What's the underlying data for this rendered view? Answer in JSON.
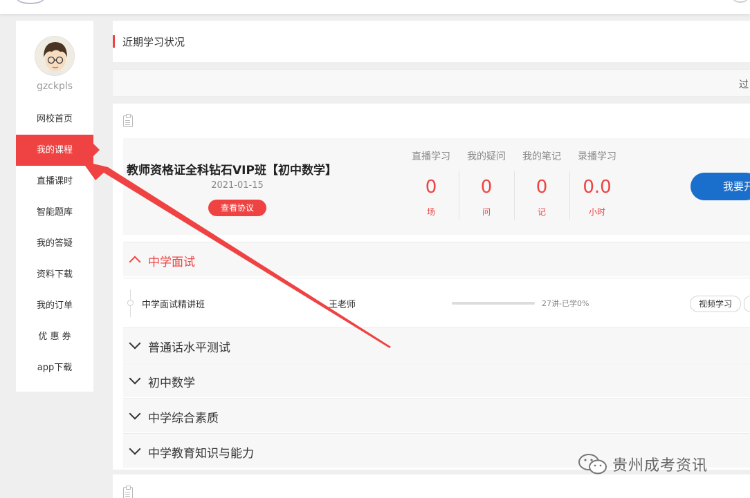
{
  "user": {
    "username": "gzckpls"
  },
  "sidebar": {
    "items": [
      {
        "label": "网校首页",
        "active": false
      },
      {
        "label": "我的课程",
        "active": true
      },
      {
        "label": "直播课时",
        "active": false
      },
      {
        "label": "智能题库",
        "active": false
      },
      {
        "label": "我的答疑",
        "active": false
      },
      {
        "label": "资料下载",
        "active": false
      },
      {
        "label": "我的订单",
        "active": false
      },
      {
        "label": "优 惠 券",
        "active": false
      },
      {
        "label": "app下载",
        "active": false
      }
    ]
  },
  "main": {
    "title": "近期学习状况",
    "filter_text": "过",
    "course": {
      "name": "教师资格证全科钻石VIP班【初中数学】",
      "date": "2021-01-15",
      "agreement_label": "查看协议",
      "stats": [
        {
          "label": "直播学习",
          "value": "0",
          "unit": "场"
        },
        {
          "label": "我的疑问",
          "value": "0",
          "unit": "问"
        },
        {
          "label": "我的笔记",
          "value": "0",
          "unit": "记"
        },
        {
          "label": "录播学习",
          "value": "0.0",
          "unit": "小时"
        }
      ],
      "start_label": "我要开"
    },
    "sections": [
      {
        "name": "中学面试",
        "open": true
      },
      {
        "name": "普通话水平测试",
        "open": false
      },
      {
        "name": "初中数学",
        "open": false
      },
      {
        "name": "中学综合素质",
        "open": false
      },
      {
        "name": "中学教育知识与能力",
        "open": false
      }
    ],
    "lesson": {
      "name": "中学面试精讲班",
      "teacher": "王老师",
      "progress": 0,
      "progress_text": "27讲-已学0%",
      "video_label": "视频学习"
    }
  },
  "colors": {
    "accent": "#ef4343",
    "primary_blue": "#1a6fcd"
  },
  "watermark": {
    "text": "贵州成考资讯"
  }
}
